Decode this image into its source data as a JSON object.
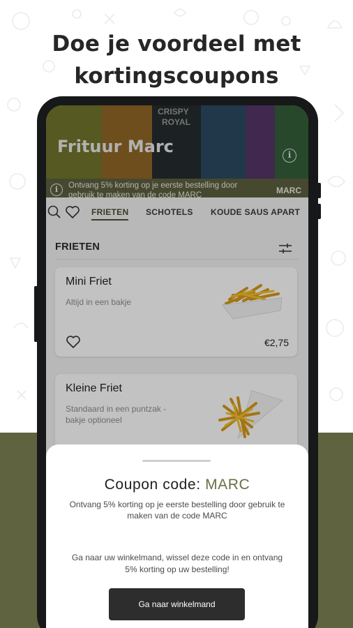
{
  "headline": {
    "line1": "Doe je voordeel met",
    "line2": "kortingscoupons"
  },
  "banner": {
    "shop_name": "Frituur Marc",
    "poster_labels": [
      "CRISPY",
      "ROYAL"
    ],
    "info_icon": "info-icon",
    "promo_icon": "info-icon",
    "promo_text": "Ontvang 5% korting op je eerste bestelling door gebruik te maken van de code MARC",
    "promo_code": "MARC"
  },
  "nav": {
    "search_icon": "search-icon",
    "favorites_icon": "heart-icon",
    "tabs": [
      {
        "label": "FRIETEN",
        "active": true
      },
      {
        "label": "SCHOTELS",
        "active": false
      },
      {
        "label": "KOUDE SAUS APART",
        "active": false
      }
    ]
  },
  "section": {
    "title": "FRIETEN",
    "filter_icon": "sliders-icon"
  },
  "products": [
    {
      "name": "Mini Friet",
      "description": "Altijd in een bakje",
      "price": "€2,75",
      "favorite_icon": "heart-icon"
    },
    {
      "name": "Kleine Friet",
      "description": "Standaard in een puntzak - bakje optioneel",
      "price": "",
      "favorite_icon": "heart-icon"
    }
  ],
  "coupon": {
    "title_prefix": "Coupon code: ",
    "code": "MARC",
    "description": "Ontvang 5% korting op je eerste bestelling door gebruik te maken van de code MARC",
    "note": "Ga naar uw winkelmand, wissel deze code in en ontvang 5% korting op uw bestelling!",
    "button_label": "Ga naar winkelmand"
  },
  "colors": {
    "brand_olive": "#606340",
    "promo_bar": "#5d6040",
    "accent_text": "#6b6e45",
    "button_dark": "#2d2d2d"
  }
}
